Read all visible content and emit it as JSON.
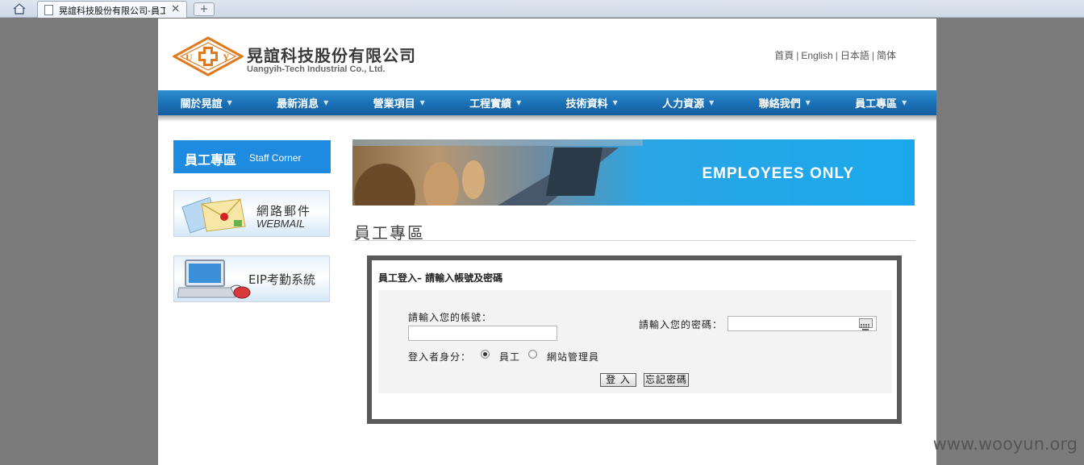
{
  "browser": {
    "tab_title": "晃誼科技股份有限公司-員工專區",
    "close_glyph": "✕",
    "new_tab_glyph": "+"
  },
  "header": {
    "company_cn": "晃誼科技股份有限公司",
    "company_en": "Uangyih-Tech Industrial Co., Ltd.",
    "logo_letters": [
      "U",
      "Y"
    ],
    "lang_links": [
      "首頁",
      "English",
      "日本語",
      "简体"
    ],
    "lang_separator": "|"
  },
  "nav": {
    "items": [
      "關於晃誼",
      "最新消息",
      "營業項目",
      "工程實績",
      "技術資料",
      "人力資源",
      "聯絡我們",
      "員工專區"
    ],
    "caret": "▼"
  },
  "sidebar": {
    "title_cn": "員工專區",
    "title_en": "Staff Corner",
    "webmail_cn": "網路郵件",
    "webmail_en": "WEBMAIL",
    "eip_label": "EIP考勤系統"
  },
  "banner": {
    "text": "EMPLOYEES ONLY"
  },
  "main": {
    "section_title": "員工專區",
    "login": {
      "heading": "員工登入– 請輸入帳號及密碼",
      "account_label": "請輸入您的帳號：",
      "account_value": "",
      "password_label": "請輸入您的密碼：",
      "password_value": "",
      "role_label": "登入者身分：",
      "role_options": [
        "員工",
        "網站管理員"
      ],
      "role_selected": "員工",
      "login_button": "登 入",
      "forgot_button": "忘記密碼"
    }
  },
  "watermark": "www.wooyun.org",
  "colors": {
    "nav_blue": "#1a6fb4",
    "staff_box_blue": "#1f8be0",
    "logo_orange": "#e07a1f",
    "login_border": "#595959"
  }
}
